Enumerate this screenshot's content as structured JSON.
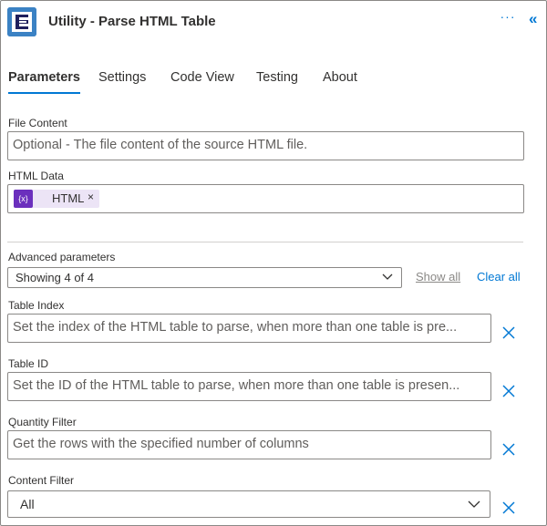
{
  "header": {
    "title": "Utility - Parse HTML Table",
    "more_label": "···",
    "collapse_label": "«",
    "logo_icon": "encodian-logo-icon",
    "logo_color": "#3b82c4"
  },
  "tabs": [
    {
      "label": "Parameters",
      "active": true
    },
    {
      "label": "Settings",
      "active": false
    },
    {
      "label": "Code View",
      "active": false
    },
    {
      "label": "Testing",
      "active": false
    },
    {
      "label": "About",
      "active": false
    }
  ],
  "fields": {
    "file_content": {
      "label": "File Content",
      "placeholder": "Optional - The file content of the source HTML file."
    },
    "html_data": {
      "label": "HTML Data",
      "token_icon": "{x}",
      "token_label": "HTML",
      "token_remove": "×"
    }
  },
  "advanced": {
    "label": "Advanced parameters",
    "selected": "Showing 4 of 4",
    "show_all": "Show all",
    "clear_all": "Clear all"
  },
  "advanced_fields": {
    "table_index": {
      "label": "Table Index",
      "placeholder": "Set the index of the HTML table to parse, when more than one table is pre..."
    },
    "table_id": {
      "label": "Table ID",
      "placeholder": "Set the ID of the HTML table to parse, when more than one table is presen..."
    },
    "quantity_filter": {
      "label": "Quantity Filter",
      "placeholder": "Get the rows with the specified number of columns"
    },
    "content_filter": {
      "label": "Content Filter",
      "value": "All"
    }
  },
  "colors": {
    "accent": "#0078d4",
    "token_bg": "#ece4f6",
    "token_icon_bg": "#6b2fbd"
  }
}
